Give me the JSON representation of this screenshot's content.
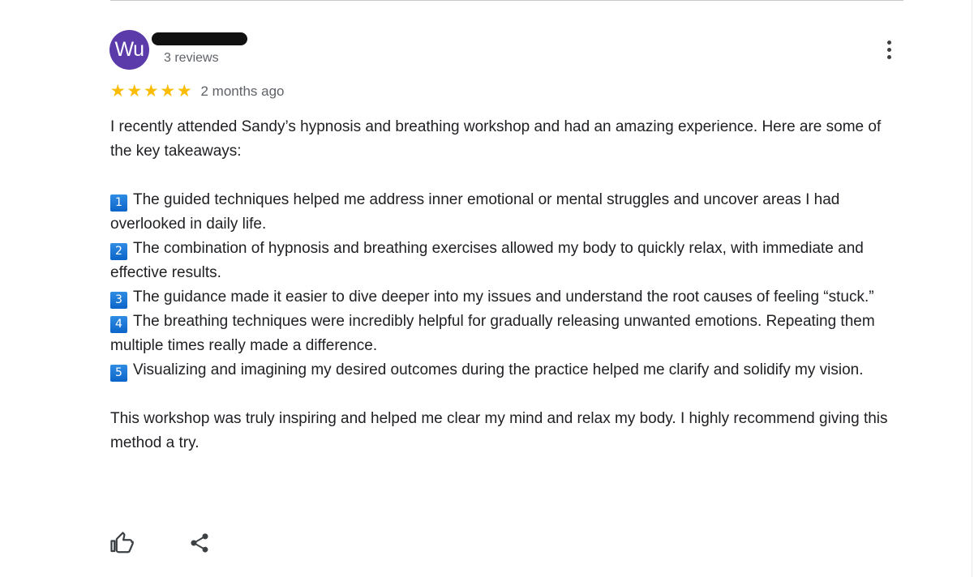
{
  "reviewer": {
    "avatar_initials": "Wu",
    "avatar_color": "#5b3aaa",
    "review_count": "3 reviews"
  },
  "rating": {
    "stars": 5,
    "max_stars": 5,
    "time_ago": "2 months ago",
    "star_color": "#fbbc04"
  },
  "review": {
    "intro": "I recently attended Sandy’s hypnosis and breathing workshop and had an amazing experience. Here are some of the key takeaways:",
    "points": [
      {
        "num": "1",
        "text": "The guided techniques helped me address inner emotional or mental struggles and uncover areas I had overlooked in daily life."
      },
      {
        "num": "2",
        "text": "The combination of hypnosis and breathing exercises allowed my body to quickly relax, with immediate and effective results."
      },
      {
        "num": "3",
        "text": "The guidance made it easier to dive deeper into my issues and understand the root causes of feeling “stuck.”"
      },
      {
        "num": "4",
        "text": "The breathing techniques were incredibly helpful for gradually releasing unwanted emotions. Repeating them multiple times really made a difference."
      },
      {
        "num": "5",
        "text": "Visualizing and imagining my desired outcomes during the practice helped me clarify and solidify my vision."
      }
    ],
    "conclusion": "This workshop was truly inspiring and helped me clear my mind and relax my body. I highly recommend giving this method a try."
  },
  "icons": {
    "more": "more-vert-icon",
    "like": "thumb-up-icon",
    "share": "share-icon"
  }
}
